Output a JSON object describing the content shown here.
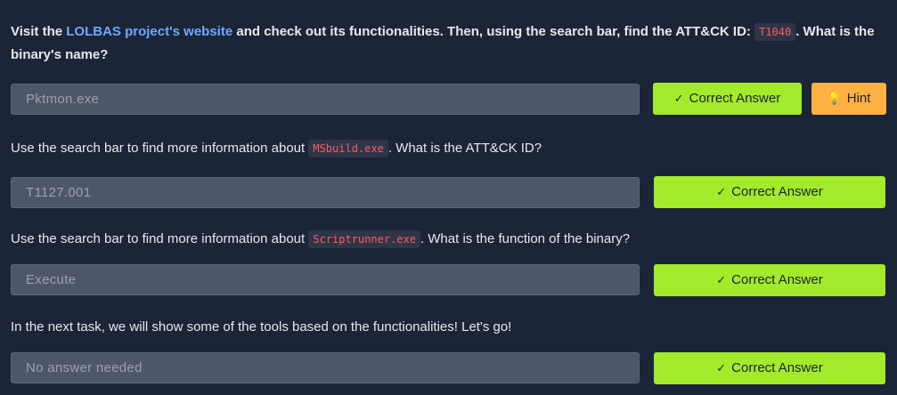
{
  "q1": {
    "pre": "Visit the ",
    "link": "LOLBAS project's website",
    "mid": " and check out its functionalities. Then, using the search bar, find the ATT&CK ID: ",
    "code": "T1040",
    "post": ". What is the binary's name?",
    "answer": "Pktmon.exe",
    "button": "Correct Answer",
    "hint": "Hint"
  },
  "q2": {
    "pre": "Use the search bar to find more information about ",
    "code": "MSbuild.exe",
    "post": ". What is the ATT&CK ID?",
    "answer": "T1127.001",
    "button": "Correct Answer"
  },
  "q3": {
    "pre": "Use the search bar to find more information about ",
    "code": "Scriptrunner.exe",
    "post": ". What is the function of the binary?",
    "answer": "Execute",
    "button": "Correct Answer"
  },
  "q4": {
    "text": "In the next task, we will show some of the tools based on the functionalities! Let's go!",
    "answer": "No answer needed",
    "button": "Correct Answer"
  },
  "colors": {
    "correct": "#a3ea2a",
    "hint": "#ffb142",
    "background": "#1c2538",
    "code": "#ff5a5f"
  },
  "icons": {
    "correct": "check-icon",
    "hint": "lightbulb-icon"
  }
}
